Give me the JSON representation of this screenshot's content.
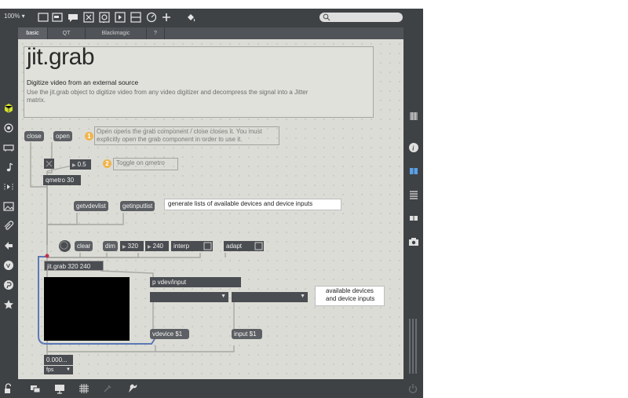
{
  "toolbar": {
    "zoom": "100% ▾",
    "icons": [
      "presentation-icon",
      "inspector-icon",
      "comment-icon",
      "bang-icon",
      "toggle-icon",
      "message-icon",
      "button-icon",
      "dial-icon",
      "add-object-icon",
      "paint-bucket-icon"
    ],
    "search_placeholder": ""
  },
  "tabs": [
    {
      "label": "basic",
      "active": true
    },
    {
      "label": "QT",
      "active": false
    },
    {
      "label": "Blackmagic",
      "active": false
    },
    {
      "label": "?",
      "active": false
    }
  ],
  "help": {
    "title": "jit.grab",
    "subtitle": "Digitize video from an external source",
    "description": "Use the jit.grab object to digitize video from any video digitizer and decompress the signal into a Jitter matrix."
  },
  "patch": {
    "close_label": "close",
    "open_label": "open",
    "note1_number": "1",
    "note1_text": "Open opens the grab component / close closes it. You must explicitly open the grab component in order to use it.",
    "note2_number": "2",
    "note2_text": "Toggle on qmetro",
    "number_value": "0.5",
    "qmetro_label": "qmetro 30",
    "getvdevlist_label": "getvdevlist",
    "getinputlist_label": "getinputlist",
    "lists_comment": "generate lists of available devices and device inputs",
    "clear_label": "clear",
    "dim_label": "dim",
    "dim_w": "320",
    "dim_h": "240",
    "interp_label": "interp",
    "adapt_label": "adapt",
    "grab_label": "jit.grab 320 240",
    "vdev_label": "p vdev/input",
    "devices_comment": "available devices and device inputs",
    "vdevice_label": "vdevice $1",
    "input_label": "input $1",
    "fps_value": "0.000...",
    "fps_label": "fps"
  },
  "colors": {
    "chrome": "#3f4245",
    "canvas": "#dcdcd6",
    "object": "#4a4d51",
    "patchcord": "#a8a8a4",
    "selected_cord": "#5b79b5",
    "badge": "#f0b44d"
  }
}
